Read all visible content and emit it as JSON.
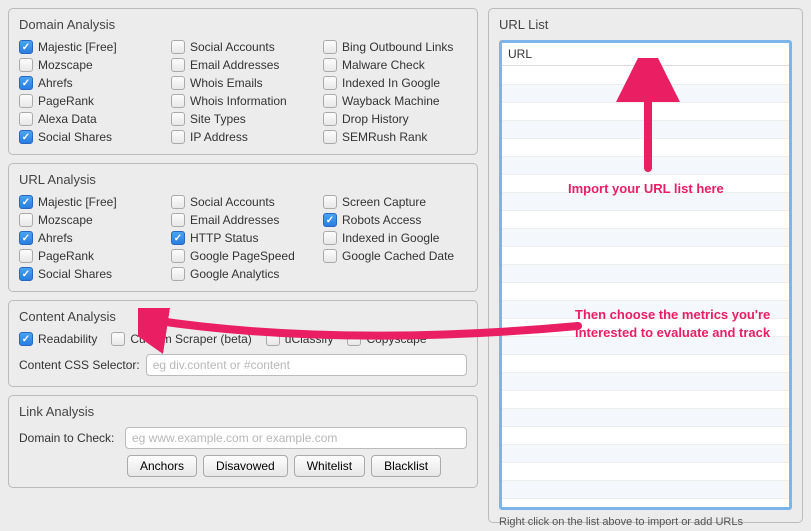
{
  "domain_analysis": {
    "title": "Domain Analysis",
    "items": [
      {
        "label": "Majestic [Free]",
        "checked": true
      },
      {
        "label": "Social Accounts",
        "checked": false
      },
      {
        "label": "Bing Outbound Links",
        "checked": false
      },
      {
        "label": "Mozscape",
        "checked": false
      },
      {
        "label": "Email Addresses",
        "checked": false
      },
      {
        "label": "Malware Check",
        "checked": false
      },
      {
        "label": "Ahrefs",
        "checked": true
      },
      {
        "label": "Whois Emails",
        "checked": false
      },
      {
        "label": "Indexed In Google",
        "checked": false
      },
      {
        "label": "PageRank",
        "checked": false
      },
      {
        "label": "Whois Information",
        "checked": false
      },
      {
        "label": "Wayback Machine",
        "checked": false
      },
      {
        "label": "Alexa Data",
        "checked": false
      },
      {
        "label": "Site Types",
        "checked": false
      },
      {
        "label": "Drop History",
        "checked": false
      },
      {
        "label": "Social Shares",
        "checked": true
      },
      {
        "label": "IP Address",
        "checked": false
      },
      {
        "label": "SEMRush Rank",
        "checked": false
      }
    ]
  },
  "url_analysis": {
    "title": "URL Analysis",
    "items": [
      {
        "label": "Majestic [Free]",
        "checked": true
      },
      {
        "label": "Social Accounts",
        "checked": false
      },
      {
        "label": "Screen Capture",
        "checked": false
      },
      {
        "label": "Mozscape",
        "checked": false
      },
      {
        "label": "Email Addresses",
        "checked": false
      },
      {
        "label": "Robots Access",
        "checked": true
      },
      {
        "label": "Ahrefs",
        "checked": true
      },
      {
        "label": "HTTP Status",
        "checked": true
      },
      {
        "label": "Indexed in Google",
        "checked": false
      },
      {
        "label": "PageRank",
        "checked": false
      },
      {
        "label": "Google PageSpeed",
        "checked": false
      },
      {
        "label": "Google Cached Date",
        "checked": false
      },
      {
        "label": "Social Shares",
        "checked": true
      },
      {
        "label": "Google Analytics",
        "checked": false
      }
    ]
  },
  "content_analysis": {
    "title": "Content Analysis",
    "items": [
      {
        "label": "Readability",
        "checked": true
      },
      {
        "label": "Custom Scraper (beta)",
        "checked": false
      },
      {
        "label": "uClassify",
        "checked": false
      },
      {
        "label": "Copyscape",
        "checked": false
      }
    ],
    "selector_label": "Content CSS Selector:",
    "selector_placeholder": "eg div.content or #content"
  },
  "link_analysis": {
    "title": "Link Analysis",
    "domain_label": "Domain to Check:",
    "domain_placeholder": "eg www.example.com or example.com",
    "buttons": [
      "Anchors",
      "Disavowed",
      "Whitelist",
      "Blacklist"
    ]
  },
  "url_list": {
    "title": "URL List",
    "column": "URL",
    "help": "Right click on the list above to import or add URLs"
  },
  "annotations": {
    "import": "Import your URL list here",
    "choose": "Then choose the metrics you're interested to evaluate and track"
  }
}
